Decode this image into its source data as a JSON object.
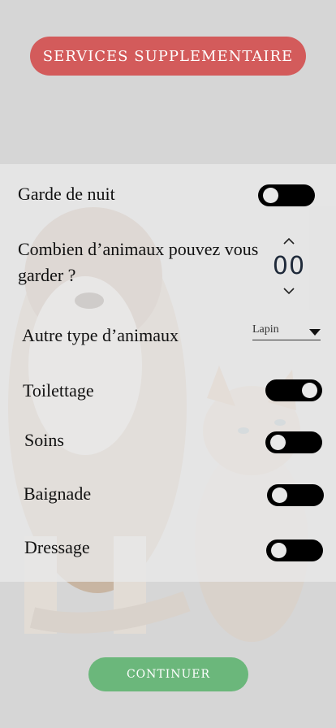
{
  "header": {
    "title": "SERVICES SUPPLEMENTAIRE"
  },
  "options": {
    "night_care": {
      "label": "Garde de nuit",
      "enabled": false
    },
    "animal_count": {
      "label": "Combien d’animaux pouvez vous garder ?",
      "value": "00"
    },
    "other_animal": {
      "label": "Autre type d’animaux",
      "selected": "Lapin"
    },
    "grooming": {
      "label": "Toilettage",
      "enabled": true
    },
    "care": {
      "label": "Soins",
      "enabled": false
    },
    "bathing": {
      "label": "Baignade",
      "enabled": false
    },
    "training": {
      "label": "Dressage",
      "enabled": false
    }
  },
  "footer": {
    "continue_label": "CONTINUER"
  },
  "colors": {
    "header": "#d35b5b",
    "continue": "#6bb77b",
    "toggle": "#000000"
  }
}
